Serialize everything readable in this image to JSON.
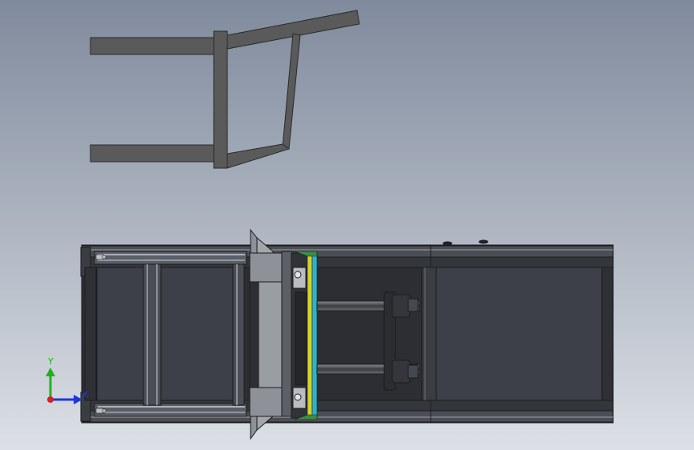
{
  "viewport": {
    "background_top": "#7f8a9c",
    "background_bottom": "#dce0e6"
  },
  "colors": {
    "frame_dark": "#2c2e33",
    "frame_mid": "#55585e",
    "panel_fill": "#3d4048",
    "rail_light": "#c9ccd2",
    "sketch_fill": "#5a5a5a",
    "accent_yellow": "#d6d22a",
    "accent_cyan": "#2fb3c6",
    "plate_gray": "#8d9096"
  },
  "triad": {
    "y_label": "Y",
    "x_label": "X",
    "y_color": "#22b022",
    "x_color": "#2233dd",
    "origin_color": "#d82020"
  }
}
